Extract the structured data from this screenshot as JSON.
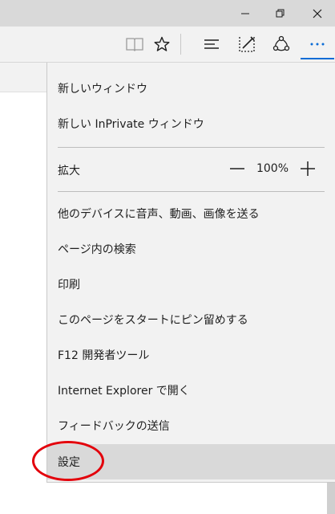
{
  "window": {
    "minimize_icon": "minimize-icon",
    "restore_icon": "restore-icon",
    "close_icon": "close-icon"
  },
  "toolbar": {
    "icons": [
      "reading-view-icon",
      "favorites-star-icon",
      "hub-icon",
      "web-note-icon",
      "share-icon",
      "more-icon"
    ],
    "accent": "#0a6cd6"
  },
  "menu": {
    "new_window": "新しいウィンドウ",
    "new_inprivate": "新しい InPrivate ウィンドウ",
    "zoom_label": "拡大",
    "zoom_value": "100%",
    "cast": "他のデバイスに音声、動画、画像を送る",
    "find": "ページ内の検索",
    "print": "印刷",
    "pin": "このページをスタートにピン留めする",
    "devtools": "F12 開発者ツール",
    "open_ie": "Internet Explorer で開く",
    "feedback": "フィードバックの送信",
    "settings": "設定"
  },
  "colors": {
    "highlight": "#e3000b",
    "menu_bg": "#f2f2f2",
    "selected_bg": "#d9d9d9"
  }
}
